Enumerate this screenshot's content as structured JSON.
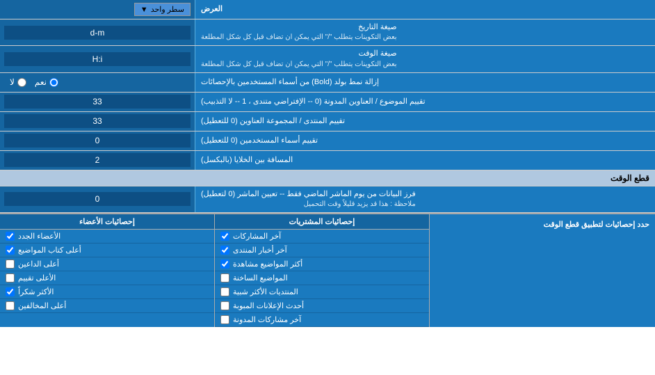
{
  "header": {
    "label": "العرض",
    "dropdown_label": "سطر واحد"
  },
  "rows": [
    {
      "id": "date_format",
      "label": "صيغة التاريخ",
      "sublabel": "بعض التكوينات يتطلب \"/\" التي يمكن ان تضاف قبل كل شكل المطلعة",
      "value": "d-m",
      "type": "text"
    },
    {
      "id": "time_format",
      "label": "صيغة الوقت",
      "sublabel": "بعض التكوينات يتطلب \"/\" التي يمكن ان تضاف قبل كل شكل المطلعة",
      "value": "H:i",
      "type": "text"
    },
    {
      "id": "bold_remove",
      "label": "إزالة نمط بولد (Bold) من أسماء المستخدمين بالإحصائات",
      "type": "radio",
      "options": [
        {
          "label": "نعم",
          "value": "yes"
        },
        {
          "label": "لا",
          "value": "no"
        }
      ],
      "selected": "yes"
    },
    {
      "id": "topic_order",
      "label": "تقييم الموضوع / العناوين المدونة (0 -- الإفتراضي متندى ، 1 -- لا التذبيب)",
      "value": "33",
      "type": "text"
    },
    {
      "id": "forum_order",
      "label": "تقييم المنتدى / المجموعة العناوين (0 للتعطيل)",
      "value": "33",
      "type": "text"
    },
    {
      "id": "usernames_order",
      "label": "تقييم أسماء المستخدمين (0 للتعطيل)",
      "value": "0",
      "type": "text"
    },
    {
      "id": "cell_distance",
      "label": "المسافة بين الخلايا (بالبكسل)",
      "value": "2",
      "type": "text"
    }
  ],
  "section_cut": {
    "title": "قطع الوقت",
    "row_label": "فرز البيانات من يوم الماشر الماضي فقط -- تعيين الماشر (0 لتعطيل)",
    "row_sublabel": "ملاحظة : هذا قد يزيد قليلاً وقت التحميل",
    "row_value": "0"
  },
  "limit_section": {
    "title": "حدد إحصائيات لتطبيق قطع الوقت"
  },
  "checkbox_cols": [
    {
      "id": "col1",
      "header": "إحصائيات المشتريات",
      "items": [
        "آخر المشاركات",
        "آخر أخبار المنتدى",
        "أكثر المواضيع مشاهدة",
        "المواضيع الساخنة",
        "المنتديات الأكثر شبية",
        "أحدث الإعلانات المبوبة",
        "آخر مشاركات المدونة"
      ]
    },
    {
      "id": "col2",
      "header": "إحصائيات الأعضاء",
      "items": [
        "الأعضاء الجدد",
        "أعلى كتاب المواضيع",
        "أعلى الداعين",
        "الأعلى تقييم",
        "الأكثر شكراً",
        "أعلى المخالفين"
      ]
    }
  ]
}
